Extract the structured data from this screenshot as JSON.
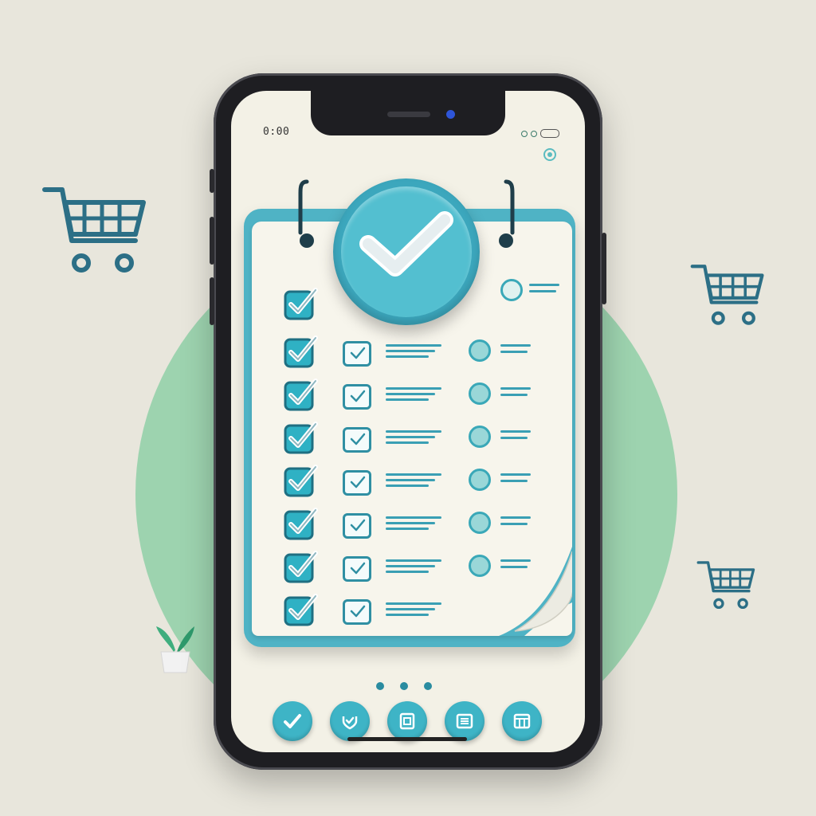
{
  "status_bar": {
    "time": "0:00"
  },
  "colors": {
    "accent": "#3eb4c6",
    "accent_dark": "#2f8fa3",
    "background": "#e8e6dc",
    "bg_circle": "#8fcfa7",
    "paper": "#f7f5ec"
  },
  "hero": {
    "icon": "check-badge-icon"
  },
  "checklist": {
    "rows": [
      {
        "completed": true,
        "secondary_checked": false,
        "radio": "partial"
      },
      {
        "completed": true,
        "secondary_checked": true,
        "radio": "filled"
      },
      {
        "completed": true,
        "secondary_checked": true,
        "radio": "filled"
      },
      {
        "completed": true,
        "secondary_checked": true,
        "radio": "filled"
      },
      {
        "completed": true,
        "secondary_checked": true,
        "radio": "filled"
      },
      {
        "completed": true,
        "secondary_checked": true,
        "radio": "filled"
      },
      {
        "completed": true,
        "secondary_checked": true,
        "radio": "filled"
      },
      {
        "completed": true,
        "secondary_checked": true,
        "radio": "none"
      }
    ]
  },
  "pager": {
    "dots": 3
  },
  "nav": {
    "items": [
      {
        "icon": "check-icon"
      },
      {
        "icon": "shield-check-icon"
      },
      {
        "icon": "clipboard-icon"
      },
      {
        "icon": "list-icon"
      },
      {
        "icon": "calendar-grid-icon"
      }
    ]
  },
  "decorations": {
    "floating_icons": [
      "shopping-cart-icon",
      "shopping-cart-icon",
      "shopping-cart-icon",
      "potted-plant-icon"
    ]
  }
}
